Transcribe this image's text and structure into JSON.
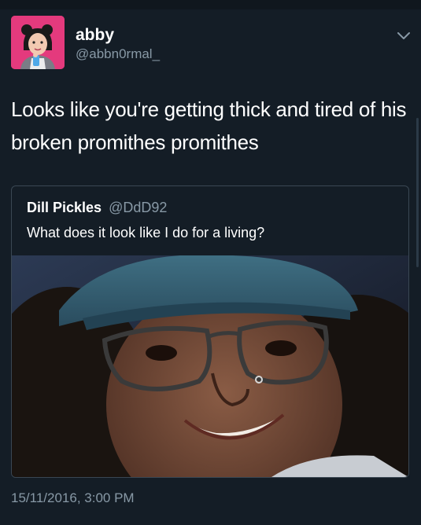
{
  "tweet": {
    "author": {
      "name": "abby",
      "handle": "@abbn0rmal_"
    },
    "text": "Looks like you're getting thick and tired of his broken promithes promithes",
    "timestamp": "15/11/2016, 3:00 PM",
    "menu_icon": "chevron-down-icon"
  },
  "quoted_tweet": {
    "author": {
      "name": "Dill Pickles",
      "handle": "@DdD92"
    },
    "text": "What does it look like I do for a living?",
    "media": "selfie-photo"
  },
  "colors": {
    "background": "#141d26",
    "primary_text": "#ffffff",
    "secondary_text": "#8899a6",
    "card_border": "#3a4753",
    "avatar_background": "#e43a7d"
  }
}
